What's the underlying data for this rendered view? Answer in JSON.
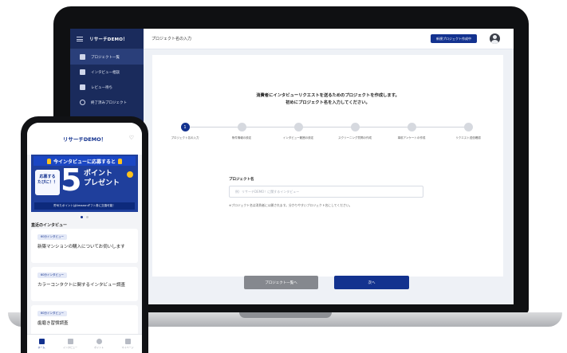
{
  "desktop": {
    "sidebar": {
      "brand": "リサーチDEMO！",
      "items": [
        {
          "label": "プロジェクト一覧",
          "active": true
        },
        {
          "label": "インタビュー相談",
          "active": false
        },
        {
          "label": "レビュー待ち",
          "active": false
        },
        {
          "label": "終了済みプロジェクト",
          "active": false
        }
      ]
    },
    "topbar": {
      "title": "プロジェクト名の入力",
      "new_project_label": "新規プロジェクト作成中"
    },
    "main": {
      "intro_line1": "消費者にインタビューリクエストを送るためのプロジェクトを作成します。",
      "intro_line2": "初めにプロジェクト名を入力してください。",
      "steps": [
        {
          "num": "1",
          "label": "プロジェクト名の入力",
          "active": true
        },
        {
          "num": "",
          "label": "条件情報の設定",
          "active": false
        },
        {
          "num": "",
          "label": "インタビュー範囲の設定",
          "active": false
        },
        {
          "num": "",
          "label": "スクリーニング質問の作成",
          "active": false
        },
        {
          "num": "",
          "label": "事前アンケートの作成",
          "active": false
        },
        {
          "num": "",
          "label": "リクエスト送信確認",
          "active": false
        }
      ],
      "field_label": "プロジェクト名",
      "field_placeholder": "例）リサーチDEMO！に関するインタビュー",
      "hint": "※プロジェクト名は消費者に公開されます。分かりやすいプロジェクト名にしてください。",
      "back_label": "プロジェクト一覧へ",
      "next_label": "次へ"
    }
  },
  "phone": {
    "title": "リサーチDEMO！",
    "banner": {
      "headline": "今インタビューに応募すると",
      "left_line1": "応募する",
      "left_line2": "たびに！！",
      "big_number": "5",
      "points_line1": "ポイント",
      "points_line2": "プレゼント",
      "footer": "貯めたポイントはAmazonギフト券に交換可能！"
    },
    "section_title": "直近のインタビュー",
    "cards": [
      {
        "tag": "60分インタビュー",
        "text": "新築マンションの購入についてお伺いします"
      },
      {
        "tag": "60分インタビュー",
        "text": "カラーコンタクトに関するインタビュー調査"
      },
      {
        "tag": "60分インタビュー",
        "text": "歯磨き習慣調査"
      }
    ],
    "tabs": [
      {
        "label": "ホーム",
        "active": true
      },
      {
        "label": "インタビュー",
        "active": false
      },
      {
        "label": "ポイント",
        "active": false
      },
      {
        "label": "マイページ",
        "active": false
      }
    ]
  },
  "colors": {
    "brand": "#13328f",
    "sidebar": "#1a2b5c",
    "banner": "#1f3f9c",
    "accent_yellow": "#ffc21a"
  }
}
